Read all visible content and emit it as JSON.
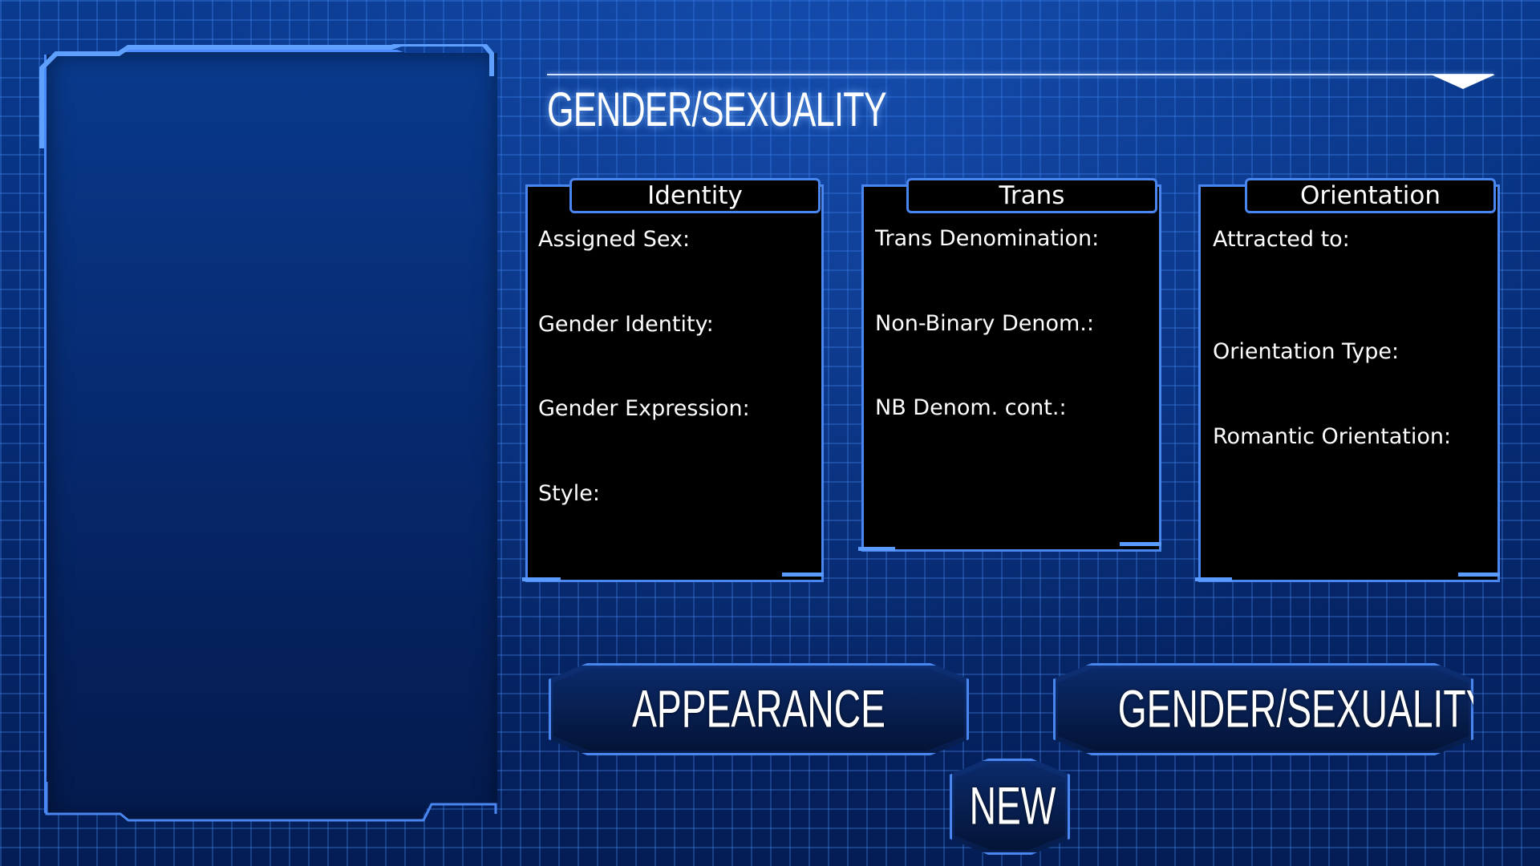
{
  "section": {
    "title": "GENDER/SEXUALITY"
  },
  "panels": {
    "identity": {
      "title": "Identity",
      "fields": [
        "Assigned Sex:",
        "Gender Identity:",
        "Gender Expression:",
        "Style:"
      ]
    },
    "trans": {
      "title": "Trans",
      "fields": [
        "Trans Denomination:",
        "Non-Binary Denom.:",
        "NB Denom. cont.:"
      ]
    },
    "orientation": {
      "title": "Orientation",
      "fields": [
        "Attracted to:",
        "Orientation Type:",
        "Romantic Orientation:"
      ]
    }
  },
  "buttons": {
    "appearance": "APPEARANCE",
    "gender_sexuality": "GENDER/SEXUALITY",
    "new": "NEW"
  },
  "colors": {
    "background": "#06276a",
    "grid_line": "#5096ff",
    "border_accent": "#4a86f0",
    "panel_fill": "#000000",
    "text": "#ffffff"
  },
  "icons": {
    "header_arrow": "dropdown-triangle-icon"
  }
}
